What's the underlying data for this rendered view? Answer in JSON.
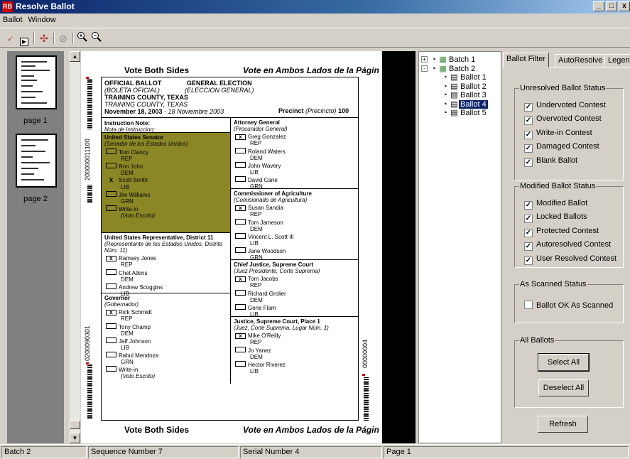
{
  "window": {
    "title": "Resolve Ballot",
    "app_icon": "RB",
    "min": "_",
    "max": "□",
    "close": "x"
  },
  "menu": [
    "Ballot",
    "Window"
  ],
  "toolbar": {
    "icons": [
      "resolve-icon",
      "play-icon",
      "batch-icon",
      "cancel-icon",
      "zoom-in-icon",
      "zoom-out-icon"
    ]
  },
  "thumbnails": [
    {
      "label": "page 1"
    },
    {
      "label": "page 2"
    }
  ],
  "ballot": {
    "header_left": "Vote Both Sides",
    "header_right": "Vote en Ambos Lados de la Págin",
    "footer_left": "Vote Both Sides",
    "footer_right": "Vote en Ambos Lados de la Págin",
    "official": "OFFICIAL BALLOT",
    "official_es": "(BOLETA OFICIAL)",
    "general": "GENERAL ELECTION",
    "general_es": "(ELECCION GENERAL)",
    "county": "TRAINING COUNTY, TEXAS",
    "county_it": "TRAINING COUNTY, TEXAS",
    "date": "November 18, 2003",
    "date_es": " - 18 Noviembre 2003",
    "precinct_label": "Precinct",
    "precinct_es": "(Precincto)",
    "precinct": "100",
    "barcode_left_top": "200000011100",
    "barcode_left_bottom": "0200090301",
    "barcode_right": "00000004",
    "instruction_title": "Instruction Note:",
    "instruction_es": "Nota de Instruccion:",
    "col1": [
      {
        "title": "United States Senator",
        "es": "(Senador de los Estados Unidos)",
        "highlight": true,
        "candidates": [
          {
            "name": "Tom Clancy",
            "party": "REP",
            "mark": ""
          },
          {
            "name": "Ron John",
            "party": "DEM",
            "mark": ""
          },
          {
            "name": "Scott Smith",
            "party": "LIB",
            "mark": "x"
          },
          {
            "name": "Jim Williams",
            "party": "GRN",
            "mark": ""
          },
          {
            "name": "Write-in",
            "party": "(Voto Escrito)",
            "mark": ""
          }
        ]
      },
      {
        "title": "United States Representative, District 11",
        "es": "(Representante de los Estados Unidos, Distrito Núm. 11)",
        "candidates": [
          {
            "name": "Ramsey Jones",
            "party": "REP",
            "mark": "x"
          },
          {
            "name": "Chet Atkins",
            "party": "DEM",
            "mark": ""
          },
          {
            "name": "Andrew Scoggins",
            "party": "LIB",
            "mark": ""
          }
        ]
      },
      {
        "title": "Governor",
        "es": "(Gobernador)",
        "candidates": [
          {
            "name": "Rick Schmidt",
            "party": "REP",
            "mark": "x"
          },
          {
            "name": "Tony Champ",
            "party": "DEM",
            "mark": ""
          },
          {
            "name": "Jeff Johnson",
            "party": "LIB",
            "mark": ""
          },
          {
            "name": "Rahul Mendoza",
            "party": "GRN",
            "mark": ""
          },
          {
            "name": "Write-in",
            "party": "(Voto Escrito)",
            "mark": ""
          }
        ]
      }
    ],
    "col2": [
      {
        "title": "Attorney General",
        "es": "(Procurador General)",
        "candidates": [
          {
            "name": "Greg Gonzalez",
            "party": "REP",
            "mark": "x"
          },
          {
            "name": "Roland Waters",
            "party": "DEM",
            "mark": ""
          },
          {
            "name": "John Wavery",
            "party": "LIB",
            "mark": ""
          },
          {
            "name": "David Cane",
            "party": "GRN",
            "mark": ""
          }
        ]
      },
      {
        "title": "Commissioner of Agriculture",
        "es": "(Comisionado de Agricultura)",
        "candidates": [
          {
            "name": "Susan Sandia",
            "party": "REP",
            "mark": "x"
          },
          {
            "name": "Tom Jameson",
            "party": "DEM",
            "mark": ""
          },
          {
            "name": "Vincent L. Scott III",
            "party": "LIB",
            "mark": ""
          },
          {
            "name": "Jane Woodson",
            "party": "GRN",
            "mark": ""
          }
        ]
      },
      {
        "title": "Chief Justice, Supreme Court",
        "es": "(Juez Presidente, Corte Suprema)",
        "candidates": [
          {
            "name": "Tom Jacobs",
            "party": "REP",
            "mark": "x"
          },
          {
            "name": "Richard Grolier",
            "party": "DEM",
            "mark": ""
          },
          {
            "name": "Gene Flam",
            "party": "LIB",
            "mark": ""
          }
        ]
      },
      {
        "title": "Justice, Supreme Court, Place 1",
        "es": "(Juez, Corte Suprema, Lugar Núm. 1)",
        "candidates": [
          {
            "name": "Mike O'Reilly",
            "party": "REP",
            "mark": "x"
          },
          {
            "name": "Jo Yanez",
            "party": "DEM",
            "mark": ""
          },
          {
            "name": "Hector Riverez",
            "party": "LIB",
            "mark": ""
          }
        ]
      }
    ]
  },
  "tree": {
    "items": [
      {
        "label": "Batch 1",
        "level": 0,
        "expander": "+"
      },
      {
        "label": "Batch 2",
        "level": 0,
        "expander": "-"
      },
      {
        "label": "Ballot 1",
        "level": 1
      },
      {
        "label": "Ballot 2",
        "level": 1
      },
      {
        "label": "Ballot 3",
        "level": 1
      },
      {
        "label": "Ballot 4",
        "level": 1,
        "selected": true
      },
      {
        "label": "Ballot 5",
        "level": 1
      }
    ]
  },
  "tabs": [
    "Ballot Filter",
    "AutoResolve",
    "Legend"
  ],
  "filter": {
    "unresolved": {
      "title": "Unresolved Ballot Status",
      "items": [
        "Undervoted Contest",
        "Overvoted Contest",
        "Write-in Contest",
        "Damaged Contest",
        "Blank Ballot"
      ]
    },
    "modified": {
      "title": "Modified Ballot Status",
      "items": [
        "Modified Ballot",
        "Locked Ballots",
        "Protected Contest",
        "Autoresolved Contest",
        "User Resolved Contest"
      ]
    },
    "scanned": {
      "title": "As Scanned Status",
      "items": [
        "Ballot OK As Scanned"
      ]
    },
    "all": {
      "title": "All Ballots",
      "select_all": "Select All",
      "deselect_all": "Deselect All"
    },
    "refresh": "Refresh",
    "check_mark": "✓"
  },
  "status": {
    "batch": "Batch 2",
    "sequence": "Sequence Number 7",
    "serial": "Serial Number 4",
    "page": "Page 1"
  }
}
